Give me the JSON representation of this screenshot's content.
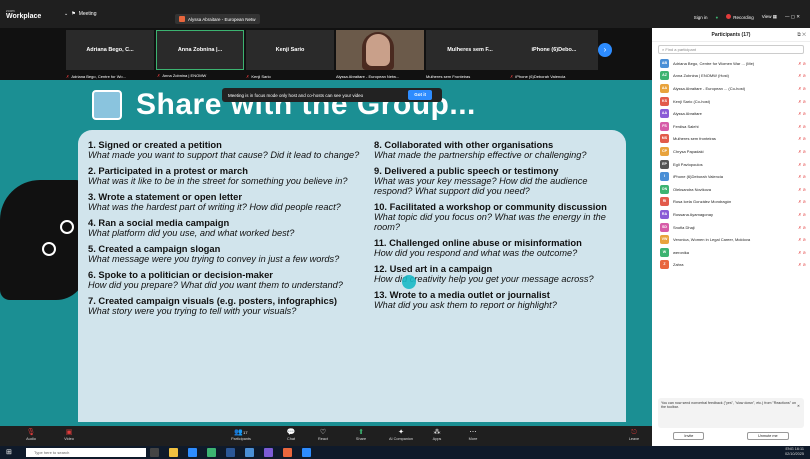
{
  "topbar": {
    "brand_small": "zoom",
    "brand_big": "Workplace",
    "meeting_label": "Meeting",
    "share_label": "Alyssa Abraitare - European Netw",
    "signin": "Sign in",
    "recording": "Recording",
    "view": "View"
  },
  "strip": {
    "tiles": [
      {
        "name": "Adriana Bego, C...",
        "label": "Adriana Bego, Centre for Wo..."
      },
      {
        "name": "Anna Zobnina |...",
        "label": "Anna Zobnina | ENOMW"
      },
      {
        "name": "Kenji Sario",
        "label": "Kenji Sario"
      },
      {
        "name": "",
        "label": "Alyssa Abraitare - European Netw..."
      },
      {
        "name": "Mulheres sem F...",
        "label": "Mulheres sem Fronteiras"
      },
      {
        "name": "iPhone (6)Debo...",
        "label": "iPhone (6)Deborah Valencia"
      }
    ]
  },
  "toast": {
    "text": "Meeting is in focus mode only host and co-hosts can see your video",
    "button": "Got it"
  },
  "slide": {
    "title": "Share with the Group...",
    "left": [
      {
        "h": "1. Signed or created a petition",
        "q": "What made you want to support that cause? Did it lead to change?"
      },
      {
        "h": "2. Participated in a protest or march",
        "q": "What was it like to be in the street for something you believe in?"
      },
      {
        "h": "3. Wrote a statement or open letter",
        "q": "What was the hardest part of writing it? How did people react?"
      },
      {
        "h": "4. Ran a social media campaign",
        "q": "What platform did you use, and what worked best?"
      },
      {
        "h": "5. Created a campaign slogan",
        "q": "What message were you trying to convey in just a few words?"
      },
      {
        "h": "6. Spoke to a politician or decision-maker",
        "q": "How did you prepare? What did you want them to understand?"
      },
      {
        "h": "7. Created campaign visuals (e.g. posters, infographics)",
        "q": "What story were you trying to tell with your visuals?"
      }
    ],
    "right": [
      {
        "h": "8. Collaborated with other organisations",
        "q": "What made the partnership effective or challenging?"
      },
      {
        "h": "9. Delivered a public speech or testimony",
        "q": "What was your key message? How did the audience respond? What support did you need?"
      },
      {
        "h": "10. Facilitated a workshop or community discussion",
        "q": "What topic did you focus on? What was the energy in the room?"
      },
      {
        "h": "11. Challenged online abuse or misinformation",
        "q": "How did you respond and what was the outcome?"
      },
      {
        "h": "12. Used art in a campaign",
        "q": "How did creativity help you get your message across?"
      },
      {
        "h": "13. Wrote to a media outlet or journalist",
        "q": "What did you ask them to report or highlight?"
      }
    ]
  },
  "toolbar": {
    "audio": "Audio",
    "video": "Video",
    "participants": "Participants",
    "participants_count": "17",
    "chat": "Chat",
    "react": "React",
    "share": "Share",
    "ai": "AI Companion",
    "apps": "Apps",
    "more": "More",
    "leave": "Leave"
  },
  "panel": {
    "title": "Participants (17)",
    "search_placeholder": "Find a participant",
    "participants": [
      {
        "initials": "AB",
        "color": "#4a8fd6",
        "name": "Adriana Bego, Centre for Women War ... (Me)"
      },
      {
        "initials": "AZ",
        "color": "#3cb371",
        "name": "Anna Zobnina | ENOMW (Host)"
      },
      {
        "initials": "AA",
        "color": "#e8a33d",
        "name": "Alyssa Abraitare - European ... (Co-host)"
      },
      {
        "initials": "KS",
        "color": "#e25b4b",
        "name": "Kenji Sario (Co-host)"
      },
      {
        "initials": "AA",
        "color": "#8a5bd6",
        "name": "Alyssa Abraitare"
      },
      {
        "initials": "FS",
        "color": "#d65ba8",
        "name": "Ferdisa Salehi"
      },
      {
        "initials": "MS",
        "color": "#e25b4b",
        "name": "Mulheres sem fronteiras"
      },
      {
        "initials": "CP",
        "color": "#e8a33d",
        "name": "Chrysa Papadaki"
      },
      {
        "initials": "EP",
        "color": "#555555",
        "name": "Egli Pavlopoulos"
      },
      {
        "initials": "I",
        "color": "#4a8fd6",
        "name": "iPhone (6)Deborah Valencia"
      },
      {
        "initials": "ON",
        "color": "#3cb371",
        "name": "Oleksandra Novikova"
      },
      {
        "initials": "RI",
        "color": "#e25b4b",
        "name": "Rosa Icela González Mondragón"
      },
      {
        "initials": "RA",
        "color": "#8a5bd6",
        "name": "Rossana Ayamagonay"
      },
      {
        "initials": "SD",
        "color": "#d65ba8",
        "name": "Snofia Dhaji"
      },
      {
        "initials": "VW",
        "color": "#e8a33d",
        "name": "Veronica, Women in Legal Career, Moldova"
      },
      {
        "initials": "W",
        "color": "#3cb371",
        "name": "weronika"
      },
      {
        "initials": "Z",
        "color": "#e8663d",
        "name": "Zahra"
      }
    ],
    "feedback": "You can now send nonverbal feedback (\"yes\", \"slow down\", etc.) from \"Reactions\" on the toolbar.",
    "invite": "Invite",
    "unmute_me": "Unmute me"
  },
  "taskbar": {
    "search_placeholder": "Type here to search",
    "lang": "ENG",
    "time": "16:11",
    "date": "02/10/2025"
  }
}
